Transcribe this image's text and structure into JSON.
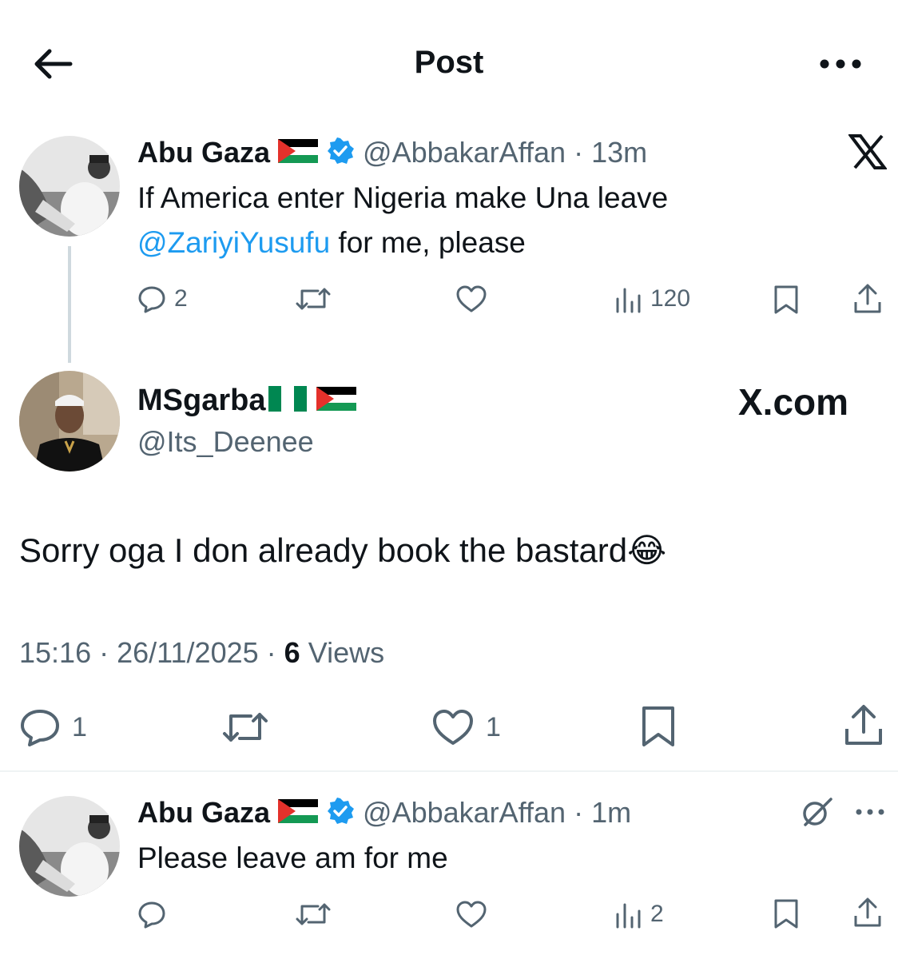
{
  "header": {
    "title": "Post",
    "back_icon": "arrow-left-icon",
    "more_icon": "more-horizontal-icon"
  },
  "colors": {
    "text": "#0f1419",
    "secondary": "#536471",
    "link": "#1d9bf0",
    "verified": "#1d9bf0"
  },
  "quoted_post": {
    "display_name": "Abu Gaza",
    "flag_icon": "palestine-flag-icon",
    "verified_icon": "verified-badge-icon",
    "handle": "@AbbakarAffan",
    "separator": "·",
    "time": "13m",
    "platform_icon": "x-logo-icon",
    "line1": "If America enter Nigeria make Una leave",
    "mention": "@ZariyiYusufu",
    "line2_rest": " for me, please",
    "actions": {
      "reply_count": "2",
      "views_count": "120"
    }
  },
  "main_post": {
    "display_name": "MSgarba",
    "flag_icons": [
      "nigeria-flag-icon",
      "palestine-flag-icon"
    ],
    "handle": "@Its_Deenee",
    "watermark": "X.com",
    "text": "Sorry oga I don already book the bastard",
    "emoji": "😂",
    "emoji_icon": "tears-of-joy-emoji-icon",
    "time": "15:16",
    "separator1": "·",
    "date": "26/11/2025",
    "separator2": "·",
    "views_count": "6",
    "views_label": "Views",
    "actions": {
      "reply_count": "1",
      "like_count": "1"
    }
  },
  "reply_post": {
    "display_name": "Abu Gaza",
    "flag_icon": "palestine-flag-icon",
    "verified_icon": "verified-badge-icon",
    "handle": "@AbbakarAffan",
    "separator": "·",
    "time": "1m",
    "grok_icon": "grok-icon",
    "more_icon": "more-horizontal-icon",
    "text": "Please leave am for me",
    "actions": {
      "views_count": "2"
    }
  }
}
